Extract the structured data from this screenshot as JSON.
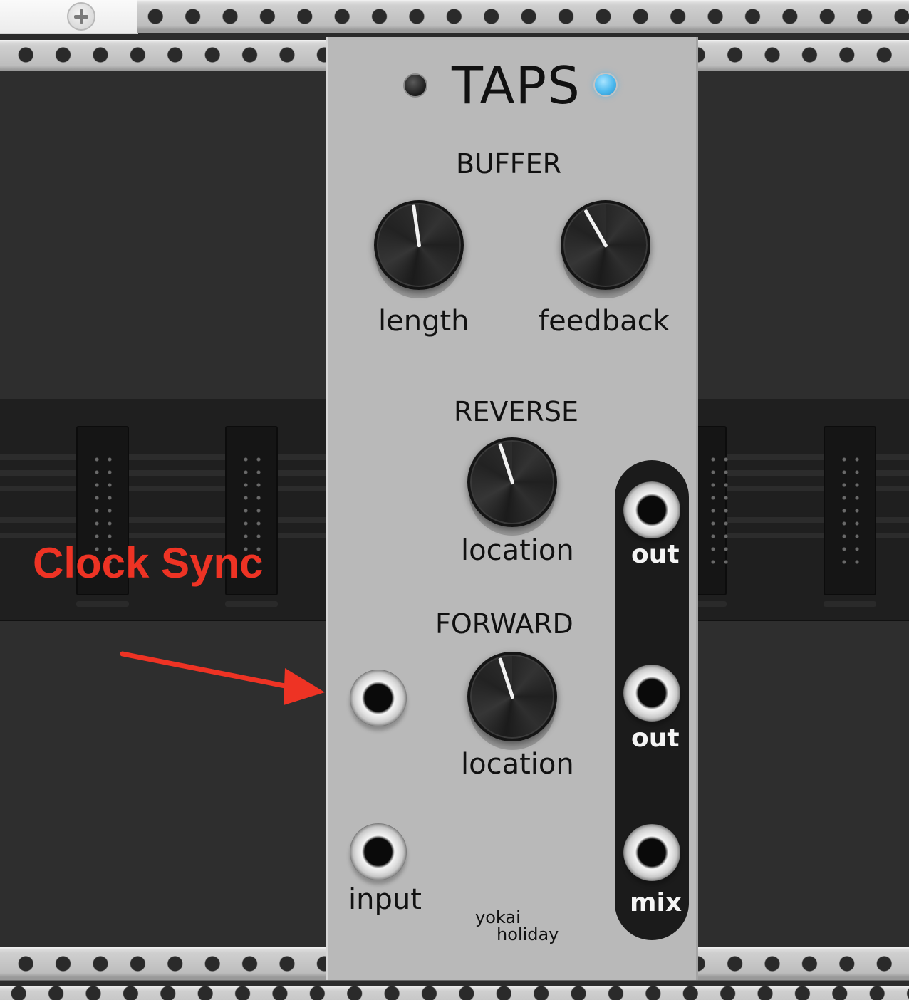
{
  "toolbar": {
    "add_button_icon": "plus-icon"
  },
  "module": {
    "title": "TAPS",
    "sections": {
      "buffer": {
        "heading": "BUFFER",
        "knob_left_label": "length",
        "knob_right_label": "feedback"
      },
      "reverse": {
        "heading": "REVERSE",
        "knob_label": "location"
      },
      "forward": {
        "heading": "FORWARD",
        "knob_label": "location"
      }
    },
    "inputs": {
      "input_label": "input"
    },
    "outputs": {
      "out1_label": "out",
      "out2_label": "out",
      "mix_label": "mix"
    },
    "brand_line1": "yokai",
    "brand_line2": "holiday",
    "status_led_left": "off",
    "status_led_right": "on",
    "colors": {
      "panel": "#b9b9b9",
      "led_on": "#4ab8ee",
      "led_off": "#2a2a2a",
      "annotation": "#ee3324"
    }
  },
  "annotation": {
    "text": "Clock Sync"
  }
}
